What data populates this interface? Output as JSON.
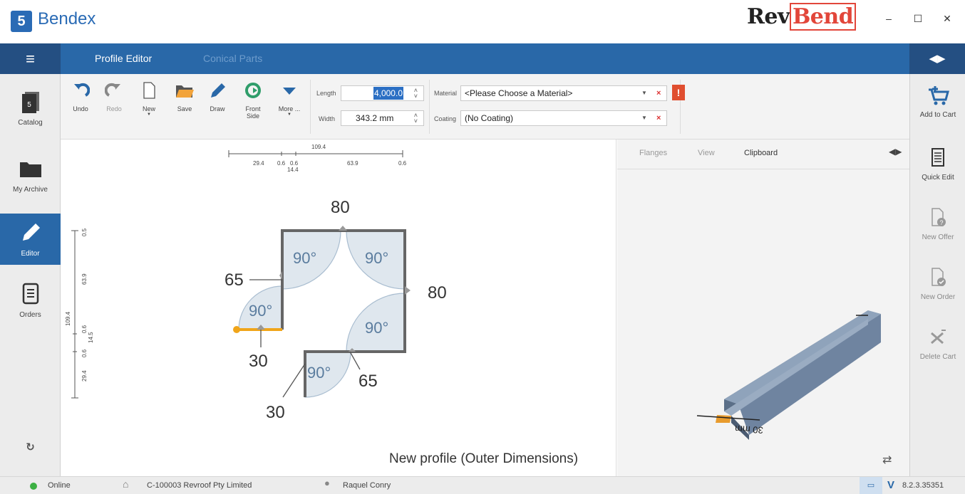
{
  "app": {
    "logo_glyph": "5",
    "name": "Bendex",
    "brand_prefix": "Rev",
    "brand_suffix": "Bend"
  },
  "window": {
    "minimize": "–",
    "maximize": "☐",
    "close": "✕"
  },
  "topbar": {
    "tabs": [
      {
        "label": "Profile Editor"
      },
      {
        "label": "Conical Parts"
      }
    ],
    "menu_icon": "≡",
    "collapse_icon": "◀▶"
  },
  "leftnav": {
    "items": [
      {
        "label": "Catalog",
        "icon": "catalog-icon"
      },
      {
        "label": "My Archive",
        "icon": "folder-icon"
      },
      {
        "label": "Editor",
        "icon": "pencil-icon"
      },
      {
        "label": "Orders",
        "icon": "document-list-icon"
      }
    ],
    "sync_icon": "↻"
  },
  "toolbar": {
    "buttons": [
      {
        "label": "Undo"
      },
      {
        "label": "Redo"
      },
      {
        "label": "New"
      },
      {
        "label": "Save"
      },
      {
        "label": "Draw"
      },
      {
        "label": "Front\nSide"
      },
      {
        "label": "More ..."
      }
    ],
    "length_label": "Length",
    "length_value": "4,000.0",
    "width_label": "Width",
    "width_value": "343.2 mm",
    "material_label": "Material",
    "material_value": "<Please Choose a Material>",
    "coating_label": "Coating",
    "coating_value": "(No Coating)",
    "warning": "!"
  },
  "rightnav": {
    "items": [
      {
        "label": "Add to Cart"
      },
      {
        "label": "Quick Edit"
      },
      {
        "label": "New Offer"
      },
      {
        "label": "New Order"
      },
      {
        "label": "Delete Cart"
      }
    ]
  },
  "canvas": {
    "top_dim_total": "109.4",
    "top_dims": [
      "29.4",
      "0.6",
      "0.6",
      "63.9",
      "0.6",
      "14.4"
    ],
    "left_dim_total": "109.4",
    "left_dims": [
      "0.5",
      "63.9",
      "0.6",
      "14.5",
      "0.6",
      "29.4"
    ],
    "lengths": [
      "80",
      "80",
      "65",
      "65",
      "30",
      "30"
    ],
    "angles": [
      "90°",
      "90°",
      "90°",
      "90°",
      "90°"
    ],
    "caption": "New profile (Outer Dimensions)"
  },
  "preview": {
    "tabs": [
      {
        "label": "Flanges"
      },
      {
        "label": "View"
      },
      {
        "label": "Clipboard"
      }
    ],
    "dim_label": "30 mm"
  },
  "status": {
    "online_label": "Online",
    "company": "C-100003 Revroof Pty Limited",
    "user": "Raquel Conry",
    "version": "8.2.3.35351",
    "online_color": "#3cb043"
  }
}
